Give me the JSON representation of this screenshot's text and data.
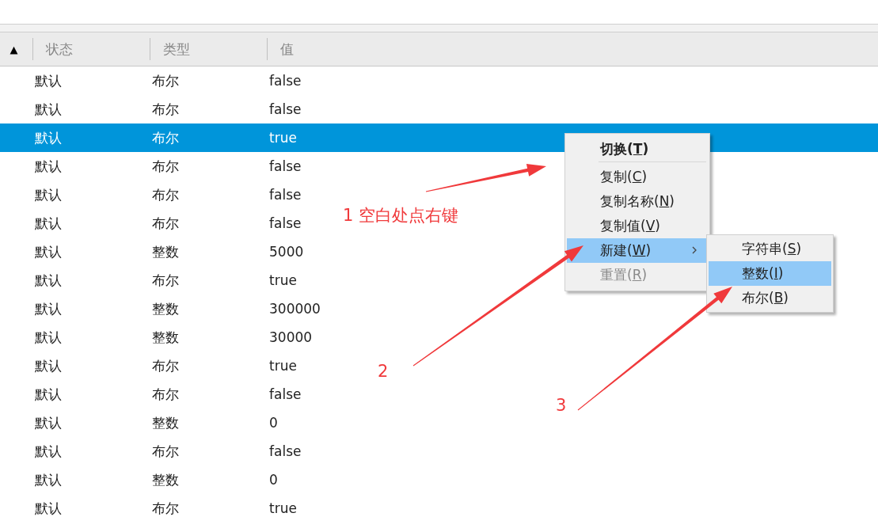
{
  "table": {
    "sort_indicator": "▲",
    "columns": [
      "状态",
      "类型",
      "值"
    ],
    "rows": [
      {
        "cells": [
          "默认",
          "布尔",
          "false"
        ],
        "selected": false
      },
      {
        "cells": [
          "默认",
          "布尔",
          "false"
        ],
        "selected": false
      },
      {
        "cells": [
          "默认",
          "布尔",
          "true"
        ],
        "selected": true
      },
      {
        "cells": [
          "默认",
          "布尔",
          "false"
        ],
        "selected": false
      },
      {
        "cells": [
          "默认",
          "布尔",
          "false"
        ],
        "selected": false
      },
      {
        "cells": [
          "默认",
          "布尔",
          "false"
        ],
        "selected": false
      },
      {
        "cells": [
          "默认",
          "整数",
          "5000"
        ],
        "selected": false
      },
      {
        "cells": [
          "默认",
          "布尔",
          "true"
        ],
        "selected": false
      },
      {
        "cells": [
          "默认",
          "整数",
          "300000"
        ],
        "selected": false
      },
      {
        "cells": [
          "默认",
          "整数",
          "30000"
        ],
        "selected": false
      },
      {
        "cells": [
          "默认",
          "布尔",
          "true"
        ],
        "selected": false
      },
      {
        "cells": [
          "默认",
          "布尔",
          "false"
        ],
        "selected": false
      },
      {
        "cells": [
          "默认",
          "整数",
          "0"
        ],
        "selected": false
      },
      {
        "cells": [
          "默认",
          "布尔",
          "false"
        ],
        "selected": false
      },
      {
        "cells": [
          "默认",
          "整数",
          "0"
        ],
        "selected": false
      },
      {
        "cells": [
          "默认",
          "布尔",
          "true"
        ],
        "selected": false
      }
    ]
  },
  "context_menu": {
    "items": [
      {
        "kind": "item",
        "before": "切换(",
        "key": "T",
        "after": ")",
        "bold": true,
        "selected": false,
        "disabled": false,
        "submenu": false
      },
      {
        "kind": "separator"
      },
      {
        "kind": "item",
        "before": "复制(",
        "key": "C",
        "after": ")",
        "bold": false,
        "selected": false,
        "disabled": false,
        "submenu": false
      },
      {
        "kind": "item",
        "before": "复制名称(",
        "key": "N",
        "after": ")",
        "bold": false,
        "selected": false,
        "disabled": false,
        "submenu": false
      },
      {
        "kind": "item",
        "before": "复制值(",
        "key": "V",
        "after": ")",
        "bold": false,
        "selected": false,
        "disabled": false,
        "submenu": false
      },
      {
        "kind": "item",
        "before": "新建(",
        "key": "W",
        "after": ")",
        "bold": false,
        "selected": true,
        "disabled": false,
        "submenu": true
      },
      {
        "kind": "item",
        "before": "重置(",
        "key": "R",
        "after": ")",
        "bold": false,
        "selected": false,
        "disabled": true,
        "submenu": false
      }
    ]
  },
  "submenu": {
    "items": [
      {
        "before": "字符串(",
        "key": "S",
        "after": ")",
        "selected": false
      },
      {
        "before": "整数(",
        "key": "I",
        "after": ")",
        "selected": true
      },
      {
        "before": "布尔(",
        "key": "B",
        "after": ")",
        "selected": false
      }
    ]
  },
  "annotations": [
    "1 空白处点右键",
    "2",
    "3"
  ]
}
